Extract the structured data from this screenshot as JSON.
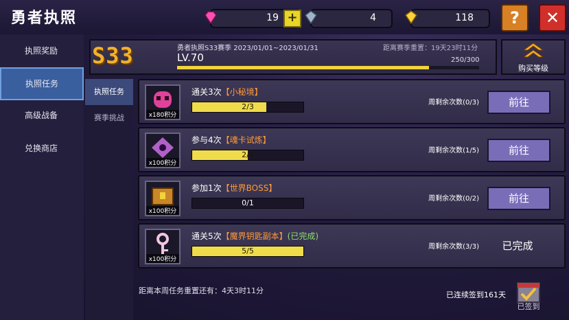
{
  "title": "勇者执照",
  "resources": [
    {
      "icon": "pink-gem-icon",
      "value": "19"
    },
    {
      "icon": "crystal-icon",
      "value": "4"
    },
    {
      "icon": "gold-gem-icon",
      "value": "118"
    }
  ],
  "help_label": "?",
  "close_label": "✕",
  "sidebar": [
    "执照奖励",
    "执照任务",
    "高级战备",
    "兑换商店"
  ],
  "header": {
    "badge": "S33",
    "season": "勇者执照S33赛季 2023/01/01~2023/01/31",
    "level": "LV.70",
    "countdown": "距离赛季重置：19天23时11分",
    "xp": "250/300",
    "xp_fraction": 0.833,
    "buy_label": "购买等级"
  },
  "subtabs": [
    "执照任务",
    "赛季挑战"
  ],
  "tasks": [
    {
      "icon": "ghost-monster-icon",
      "points": "x180积分",
      "prefix": "通关3次",
      "name": "【小秘境】",
      "suffix": "",
      "progress": "2/3",
      "fraction": 0.667,
      "weekly": "周剩余次数(0/3)",
      "action": "前往"
    },
    {
      "icon": "soul-card-icon",
      "points": "x100积分",
      "prefix": "参与4次",
      "name": "【魂卡试炼】",
      "suffix": "",
      "progress": "2/4",
      "fraction": 0.5,
      "weekly": "周剩余次数(1/5)",
      "action": "前往"
    },
    {
      "icon": "boss-chest-icon",
      "points": "x100积分",
      "prefix": "参加1次",
      "name": "【世界BOSS】",
      "suffix": "",
      "progress": "0/1",
      "fraction": 0,
      "weekly": "周剩余次数(0/2)",
      "action": "前往"
    },
    {
      "icon": "key-icon",
      "points": "x100积分",
      "prefix": "通关5次",
      "name": "【魔界钥匙副本】",
      "suffix": "(已完成)",
      "progress": "5/5",
      "fraction": 1,
      "weekly": "周剩余次数(3/3)",
      "action": "已完成"
    }
  ],
  "reset": "距离本周任务重置还有：4天3时11分",
  "signed": "已连续签到161天",
  "sign_label": "已签到",
  "colors": {
    "accent": "#f2d33a",
    "task_name": "#ff9a3a",
    "done": "#8fe06a",
    "button": "#7a6db8"
  }
}
